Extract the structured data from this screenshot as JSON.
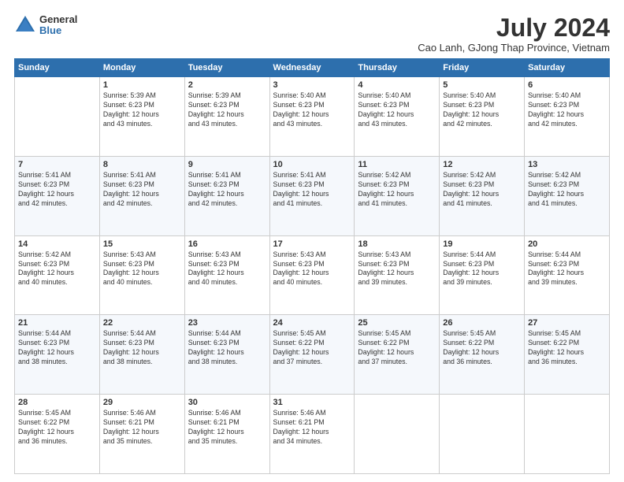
{
  "logo": {
    "general": "General",
    "blue": "Blue"
  },
  "title": "July 2024",
  "location": "Cao Lanh, GJong Thap Province, Vietnam",
  "weekdays": [
    "Sunday",
    "Monday",
    "Tuesday",
    "Wednesday",
    "Thursday",
    "Friday",
    "Saturday"
  ],
  "weeks": [
    [
      {
        "day": "",
        "info": ""
      },
      {
        "day": "1",
        "info": "Sunrise: 5:39 AM\nSunset: 6:23 PM\nDaylight: 12 hours\nand 43 minutes."
      },
      {
        "day": "2",
        "info": "Sunrise: 5:39 AM\nSunset: 6:23 PM\nDaylight: 12 hours\nand 43 minutes."
      },
      {
        "day": "3",
        "info": "Sunrise: 5:40 AM\nSunset: 6:23 PM\nDaylight: 12 hours\nand 43 minutes."
      },
      {
        "day": "4",
        "info": "Sunrise: 5:40 AM\nSunset: 6:23 PM\nDaylight: 12 hours\nand 43 minutes."
      },
      {
        "day": "5",
        "info": "Sunrise: 5:40 AM\nSunset: 6:23 PM\nDaylight: 12 hours\nand 42 minutes."
      },
      {
        "day": "6",
        "info": "Sunrise: 5:40 AM\nSunset: 6:23 PM\nDaylight: 12 hours\nand 42 minutes."
      }
    ],
    [
      {
        "day": "7",
        "info": "Sunrise: 5:41 AM\nSunset: 6:23 PM\nDaylight: 12 hours\nand 42 minutes."
      },
      {
        "day": "8",
        "info": "Sunrise: 5:41 AM\nSunset: 6:23 PM\nDaylight: 12 hours\nand 42 minutes."
      },
      {
        "day": "9",
        "info": "Sunrise: 5:41 AM\nSunset: 6:23 PM\nDaylight: 12 hours\nand 42 minutes."
      },
      {
        "day": "10",
        "info": "Sunrise: 5:41 AM\nSunset: 6:23 PM\nDaylight: 12 hours\nand 41 minutes."
      },
      {
        "day": "11",
        "info": "Sunrise: 5:42 AM\nSunset: 6:23 PM\nDaylight: 12 hours\nand 41 minutes."
      },
      {
        "day": "12",
        "info": "Sunrise: 5:42 AM\nSunset: 6:23 PM\nDaylight: 12 hours\nand 41 minutes."
      },
      {
        "day": "13",
        "info": "Sunrise: 5:42 AM\nSunset: 6:23 PM\nDaylight: 12 hours\nand 41 minutes."
      }
    ],
    [
      {
        "day": "14",
        "info": "Sunrise: 5:42 AM\nSunset: 6:23 PM\nDaylight: 12 hours\nand 40 minutes."
      },
      {
        "day": "15",
        "info": "Sunrise: 5:43 AM\nSunset: 6:23 PM\nDaylight: 12 hours\nand 40 minutes."
      },
      {
        "day": "16",
        "info": "Sunrise: 5:43 AM\nSunset: 6:23 PM\nDaylight: 12 hours\nand 40 minutes."
      },
      {
        "day": "17",
        "info": "Sunrise: 5:43 AM\nSunset: 6:23 PM\nDaylight: 12 hours\nand 40 minutes."
      },
      {
        "day": "18",
        "info": "Sunrise: 5:43 AM\nSunset: 6:23 PM\nDaylight: 12 hours\nand 39 minutes."
      },
      {
        "day": "19",
        "info": "Sunrise: 5:44 AM\nSunset: 6:23 PM\nDaylight: 12 hours\nand 39 minutes."
      },
      {
        "day": "20",
        "info": "Sunrise: 5:44 AM\nSunset: 6:23 PM\nDaylight: 12 hours\nand 39 minutes."
      }
    ],
    [
      {
        "day": "21",
        "info": "Sunrise: 5:44 AM\nSunset: 6:23 PM\nDaylight: 12 hours\nand 38 minutes."
      },
      {
        "day": "22",
        "info": "Sunrise: 5:44 AM\nSunset: 6:23 PM\nDaylight: 12 hours\nand 38 minutes."
      },
      {
        "day": "23",
        "info": "Sunrise: 5:44 AM\nSunset: 6:23 PM\nDaylight: 12 hours\nand 38 minutes."
      },
      {
        "day": "24",
        "info": "Sunrise: 5:45 AM\nSunset: 6:22 PM\nDaylight: 12 hours\nand 37 minutes."
      },
      {
        "day": "25",
        "info": "Sunrise: 5:45 AM\nSunset: 6:22 PM\nDaylight: 12 hours\nand 37 minutes."
      },
      {
        "day": "26",
        "info": "Sunrise: 5:45 AM\nSunset: 6:22 PM\nDaylight: 12 hours\nand 36 minutes."
      },
      {
        "day": "27",
        "info": "Sunrise: 5:45 AM\nSunset: 6:22 PM\nDaylight: 12 hours\nand 36 minutes."
      }
    ],
    [
      {
        "day": "28",
        "info": "Sunrise: 5:45 AM\nSunset: 6:22 PM\nDaylight: 12 hours\nand 36 minutes."
      },
      {
        "day": "29",
        "info": "Sunrise: 5:46 AM\nSunset: 6:21 PM\nDaylight: 12 hours\nand 35 minutes."
      },
      {
        "day": "30",
        "info": "Sunrise: 5:46 AM\nSunset: 6:21 PM\nDaylight: 12 hours\nand 35 minutes."
      },
      {
        "day": "31",
        "info": "Sunrise: 5:46 AM\nSunset: 6:21 PM\nDaylight: 12 hours\nand 34 minutes."
      },
      {
        "day": "",
        "info": ""
      },
      {
        "day": "",
        "info": ""
      },
      {
        "day": "",
        "info": ""
      }
    ]
  ]
}
